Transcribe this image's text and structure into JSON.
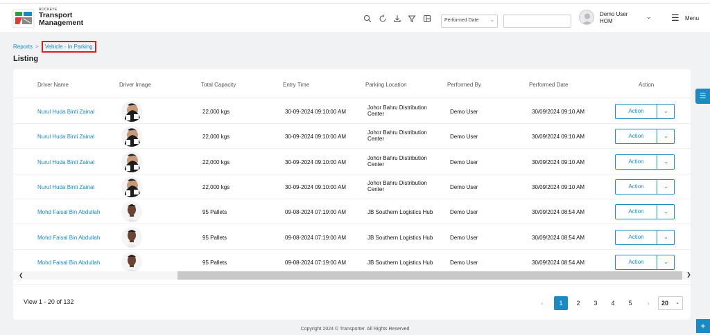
{
  "header": {
    "brand_small": "ROCKEYE",
    "brand_line1": "Transport",
    "brand_line2": "Management",
    "filter_select": "Performed Date",
    "user_name": "Demo User",
    "user_role": "HOM",
    "menu_label": "Menu"
  },
  "breadcrumb": {
    "parent": "Reports",
    "separator": ">",
    "current": "Vehicle - In Parking"
  },
  "page_title": "Listing",
  "columns": [
    "Driver Name",
    "Driver Image",
    "Total Capacity",
    "Entry Time",
    "Parking Location",
    "Performed By",
    "Performed Date",
    "Action"
  ],
  "rows": [
    {
      "driver": "Nurul Huda Binti Zainal",
      "capacity": "22,000 kgs",
      "entry": "30-09-2024 09:10:00 AM",
      "location": "Johor Bahru Distribution Center",
      "by": "Demo User",
      "date": "30/09/2024 09:10 AM",
      "action": "Action"
    },
    {
      "driver": "Nurul Huda Binti Zainal",
      "capacity": "22,000 kgs",
      "entry": "30-09-2024 09:10:00 AM",
      "location": "Johor Bahru Distribution Center",
      "by": "Demo User",
      "date": "30/09/2024 09:10 AM",
      "action": "Action"
    },
    {
      "driver": "Nurul Huda Binti Zainal",
      "capacity": "22,000 kgs",
      "entry": "30-09-2024 09:10:00 AM",
      "location": "Johor Bahru Distribution Center",
      "by": "Demo User",
      "date": "30/09/2024 09:10 AM",
      "action": "Action"
    },
    {
      "driver": "Nurul Huda Binti Zainal",
      "capacity": "22,000 kgs",
      "entry": "30-09-2024 09:10:00 AM",
      "location": "Johor Bahru Distribution Center",
      "by": "Demo User",
      "date": "30/09/2024 09:10 AM",
      "action": "Action"
    },
    {
      "driver": "Mohd Faisal Bin Abdullah",
      "capacity": "95 Pallets",
      "entry": "09-08-2024 07:19:00 AM",
      "location": "JB Southern Logistics Hub",
      "by": "Demo User",
      "date": "30/09/2024 08:54 AM",
      "action": "Action"
    },
    {
      "driver": "Mohd Faisal Bin Abdullah",
      "capacity": "95 Pallets",
      "entry": "09-08-2024 07:19:00 AM",
      "location": "JB Southern Logistics Hub",
      "by": "Demo User",
      "date": "30/09/2024 08:54 AM",
      "action": "Action"
    },
    {
      "driver": "Mohd Faisal Bin Abdullah",
      "capacity": "95 Pallets",
      "entry": "09-08-2024 07:19:00 AM",
      "location": "JB Southern Logistics Hub",
      "by": "Demo User",
      "date": "30/09/2024 08:54 AM",
      "action": "Action"
    }
  ],
  "footer": {
    "view_count": "View 1 - 20 of 132",
    "pages": [
      "1",
      "2",
      "3",
      "4",
      "5"
    ],
    "active_page": "1",
    "page_size": "20",
    "copyright": "Copyright 2024 © Transporter. All Rights Reserved"
  },
  "colors": {
    "accent": "#1a8ac5",
    "highlight": "#e01d1d"
  }
}
